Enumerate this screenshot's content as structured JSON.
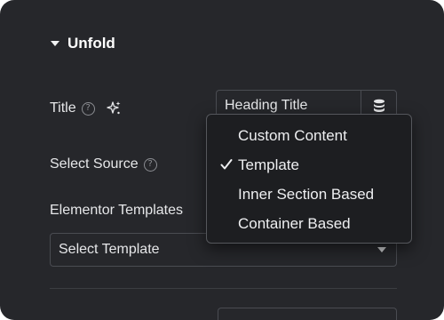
{
  "section": {
    "title": "Unfold",
    "icon": "caret-down-icon"
  },
  "title_field": {
    "label": "Title",
    "help_icon": "?",
    "value": "Heading Title",
    "ai_icon": "sparkle-icon",
    "dynamic_icon": "database-icon"
  },
  "source_field": {
    "label": "Select Source",
    "help_icon": "?"
  },
  "templates_field": {
    "label": "Elementor Templates",
    "selected": "Select Template"
  },
  "source_dropdown": {
    "selected": "Template",
    "options": [
      {
        "label": "Custom Content",
        "checked": false
      },
      {
        "label": "Template",
        "checked": true
      },
      {
        "label": "Inner Section Based",
        "checked": false
      },
      {
        "label": "Container Based",
        "checked": false
      }
    ]
  },
  "colors": {
    "panel_bg": "#26272b",
    "dropdown_bg": "#1d1e21",
    "border": "#4a4c52",
    "text": "#e6e7e9"
  }
}
